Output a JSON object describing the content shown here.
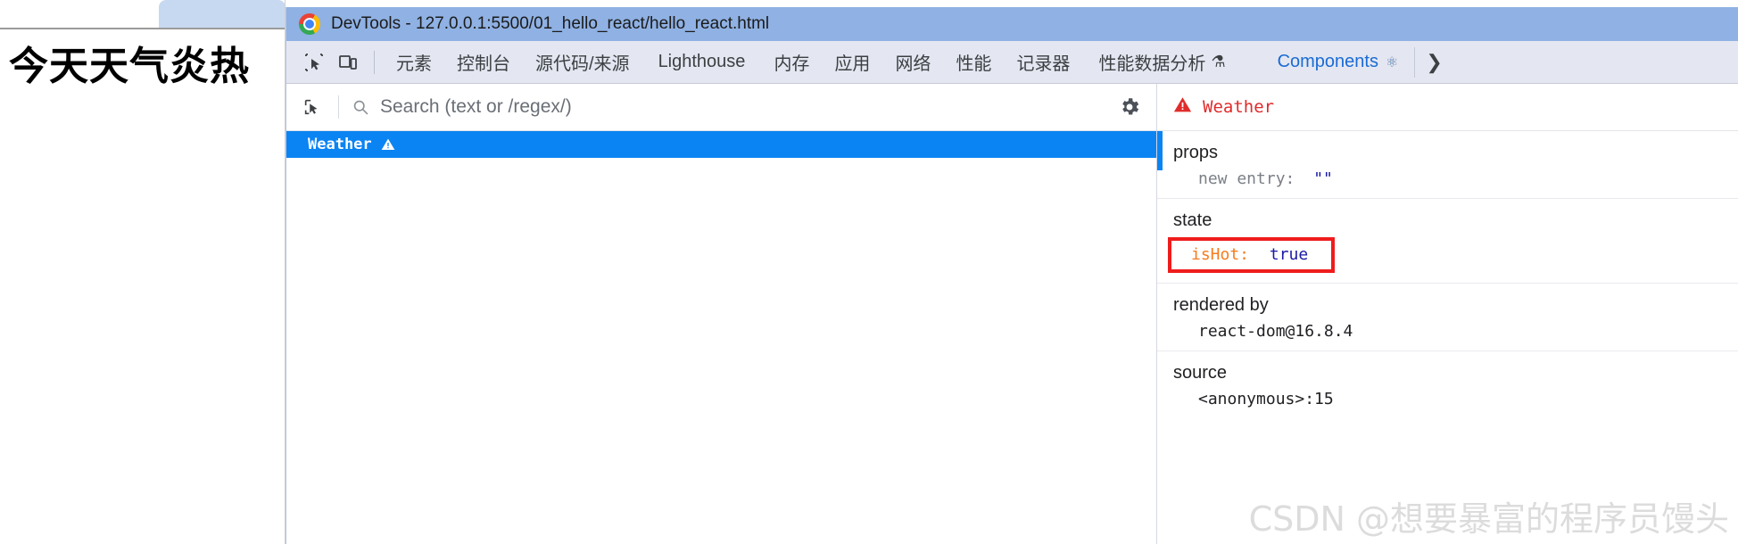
{
  "page": {
    "heading": "今天天气炎热"
  },
  "window": {
    "title": "DevTools - 127.0.0.1:5500/01_hello_react/hello_react.html",
    "logo_icon": "chrome-logo-icon"
  },
  "tabbar": {
    "inspect_icon": "inspect-element-icon",
    "device_icon": "device-toolbar-icon",
    "tabs": [
      {
        "label": "元素"
      },
      {
        "label": "控制台"
      },
      {
        "label": "源代码/来源"
      },
      {
        "label": "Lighthouse"
      },
      {
        "label": "内存"
      },
      {
        "label": "应用"
      },
      {
        "label": "网络"
      },
      {
        "label": "性能"
      },
      {
        "label": "记录器"
      },
      {
        "label": "性能数据分析",
        "suffix_icon": "flask-icon"
      }
    ],
    "active_tab": {
      "label": "Components",
      "icon": "react-atom-icon"
    },
    "overflow_icon": "chevron-right-icon"
  },
  "tree_toolbar": {
    "select_icon": "select-element-icon",
    "search_icon": "search-icon",
    "search_placeholder": "Search (text or /regex/)",
    "search_value": "",
    "settings_icon": "gear-icon"
  },
  "tree": {
    "rows": [
      {
        "label": "Weather",
        "badge_icon": "warning-triangle-icon",
        "selected": true
      }
    ]
  },
  "details": {
    "header": {
      "icon": "warning-triangle-icon",
      "name": "Weather"
    },
    "props": {
      "title": "props",
      "entries": [
        {
          "key": "new entry:",
          "value": "\"\""
        }
      ]
    },
    "state": {
      "title": "state",
      "entries": [
        {
          "key": "isHot:",
          "value": "true",
          "highlighted": true
        }
      ]
    },
    "rendered_by": {
      "title": "rendered by",
      "value": "react-dom@16.8.4"
    },
    "source": {
      "title": "source",
      "value": "<anonymous>:15"
    }
  },
  "watermark": {
    "text": "CSDN @想要暴富的程序员馒头"
  },
  "colors": {
    "titlebar": "#8fb1e3",
    "tabbar": "#e4e7f1",
    "selection_blue": "#0b84f3",
    "react_blue": "#1a6bd4",
    "error_red": "#e02b2b",
    "highlight_red": "#ef1c1c",
    "key_orange": "#f57c1f",
    "value_navy": "#1a1aa6"
  }
}
